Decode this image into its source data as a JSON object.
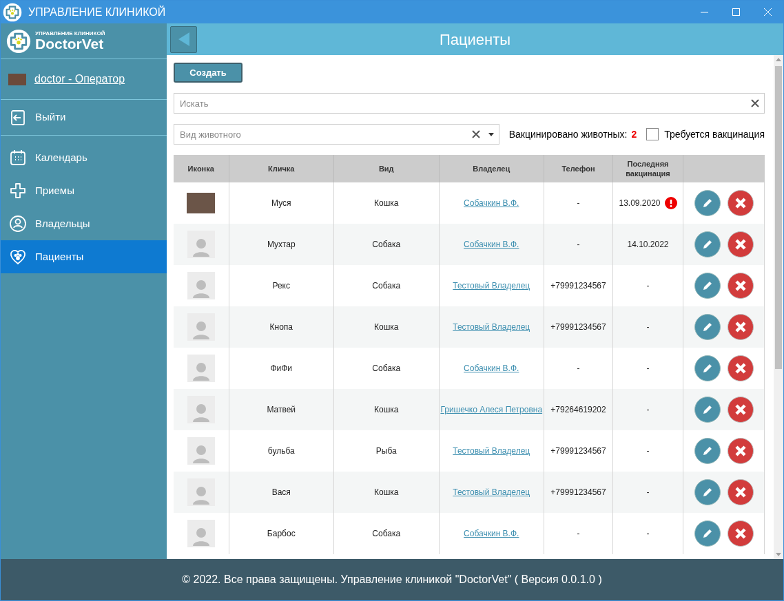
{
  "window": {
    "title": "УПРАВЛЕНИЕ КЛИНИКОЙ"
  },
  "brand": {
    "subtitle": "УПРАВЛЕНИЕ КЛИНИКОЙ",
    "name": "DoctorVet"
  },
  "user": {
    "label": "doctor - Оператор"
  },
  "logout": {
    "label": "Выйти"
  },
  "sidebar": {
    "items": [
      {
        "label": "Календарь",
        "kind": "calendar",
        "selected": false
      },
      {
        "label": "Приемы",
        "kind": "cross",
        "selected": false
      },
      {
        "label": "Владельцы",
        "kind": "person",
        "selected": false
      },
      {
        "label": "Пациенты",
        "kind": "heart",
        "selected": true
      }
    ]
  },
  "header": {
    "title": "Пациенты"
  },
  "create_button": "Создать",
  "search": {
    "placeholder": "Искать"
  },
  "species_filter": {
    "placeholder": "Вид животного"
  },
  "vaccinated": {
    "label": "Вакцинировано животных:",
    "count": "2"
  },
  "needs_vaccination": {
    "label": "Требуется вакцинация",
    "checked": false
  },
  "table": {
    "columns": [
      "Иконка",
      "Кличка",
      "Вид",
      "Владелец",
      "Телефон",
      "Последняя вакцинация"
    ],
    "rows": [
      {
        "kind": "photo",
        "name": "Муся",
        "species": "Кошка",
        "owner": "Собачкин В.Ф.",
        "phone": "-",
        "last_vaccination": "13.09.2020",
        "overdue": true
      },
      {
        "kind": "placeholder",
        "name": "Мухтар",
        "species": "Собака",
        "owner": "Собачкин В.Ф.",
        "phone": "-",
        "last_vaccination": "14.10.2022",
        "overdue": false
      },
      {
        "kind": "placeholder",
        "name": "Рекс",
        "species": "Собака",
        "owner": "Тестовый Владелец",
        "phone": "+79991234567",
        "last_vaccination": "-",
        "overdue": false
      },
      {
        "kind": "placeholder",
        "name": "Кнопа",
        "species": "Кошка",
        "owner": "Тестовый Владелец",
        "phone": "+79991234567",
        "last_vaccination": "-",
        "overdue": false
      },
      {
        "kind": "placeholder",
        "name": "ФиФи",
        "species": "Собака",
        "owner": "Собачкин В.Ф.",
        "phone": "-",
        "last_vaccination": "-",
        "overdue": false
      },
      {
        "kind": "placeholder",
        "name": "Матвей",
        "species": "Кошка",
        "owner": "Гришечко Алеся Петровна",
        "phone": "+79264619202",
        "last_vaccination": "-",
        "overdue": false
      },
      {
        "kind": "placeholder",
        "name": "бульба",
        "species": "Рыба",
        "owner": "Тестовый Владелец",
        "phone": "+79991234567",
        "last_vaccination": "-",
        "overdue": false
      },
      {
        "kind": "placeholder",
        "name": "Вася",
        "species": "Кошка",
        "owner": "Тестовый Владелец",
        "phone": "+79991234567",
        "last_vaccination": "-",
        "overdue": false
      },
      {
        "kind": "placeholder",
        "name": "Барбос",
        "species": "Собака",
        "owner": "Собачкин В.Ф.",
        "phone": "-",
        "last_vaccination": "-",
        "overdue": false
      }
    ]
  },
  "footer": "© 2022. Все права защищены. Управление клиникой \"DoctorVet\" ( Версия 0.0.1.0 )"
}
